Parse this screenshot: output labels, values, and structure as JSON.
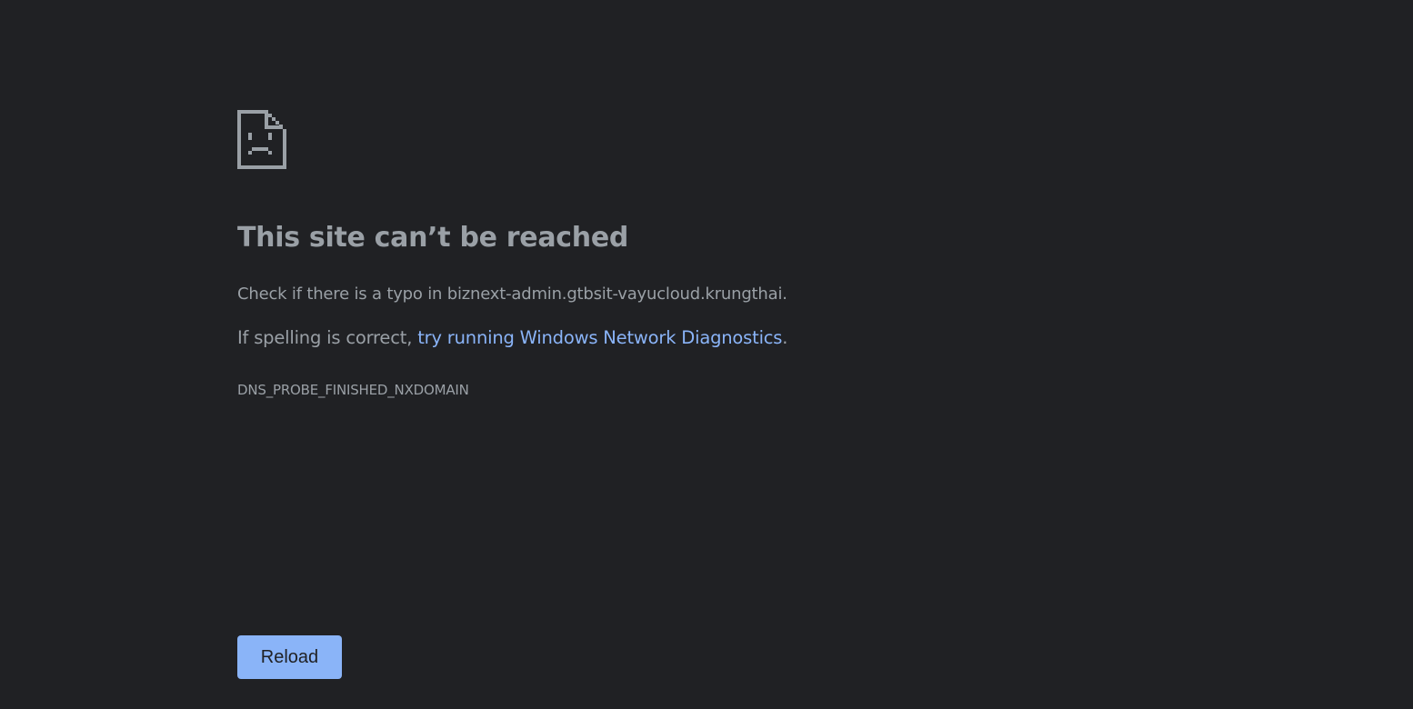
{
  "theme": {
    "background": "#202124",
    "text_color": "#9aa0a6",
    "link_color": "#8ab4f8",
    "button_color": "#8ab4f8",
    "button_text_color": "#202124"
  },
  "icon": {
    "name": "sad-page-icon"
  },
  "error": {
    "title": "This site can’t be reached",
    "typo_check": "Check if there is a typo in biznext-admin.gtbsit-vayucloud.krungthai.",
    "suggestion_prefix": "If spelling is correct, ",
    "diagnostics_link": "try running Windows Network Diagnostics",
    "suggestion_suffix": ".",
    "code": "DNS_PROBE_FINISHED_NXDOMAIN"
  },
  "actions": {
    "reload_label": "Reload"
  }
}
